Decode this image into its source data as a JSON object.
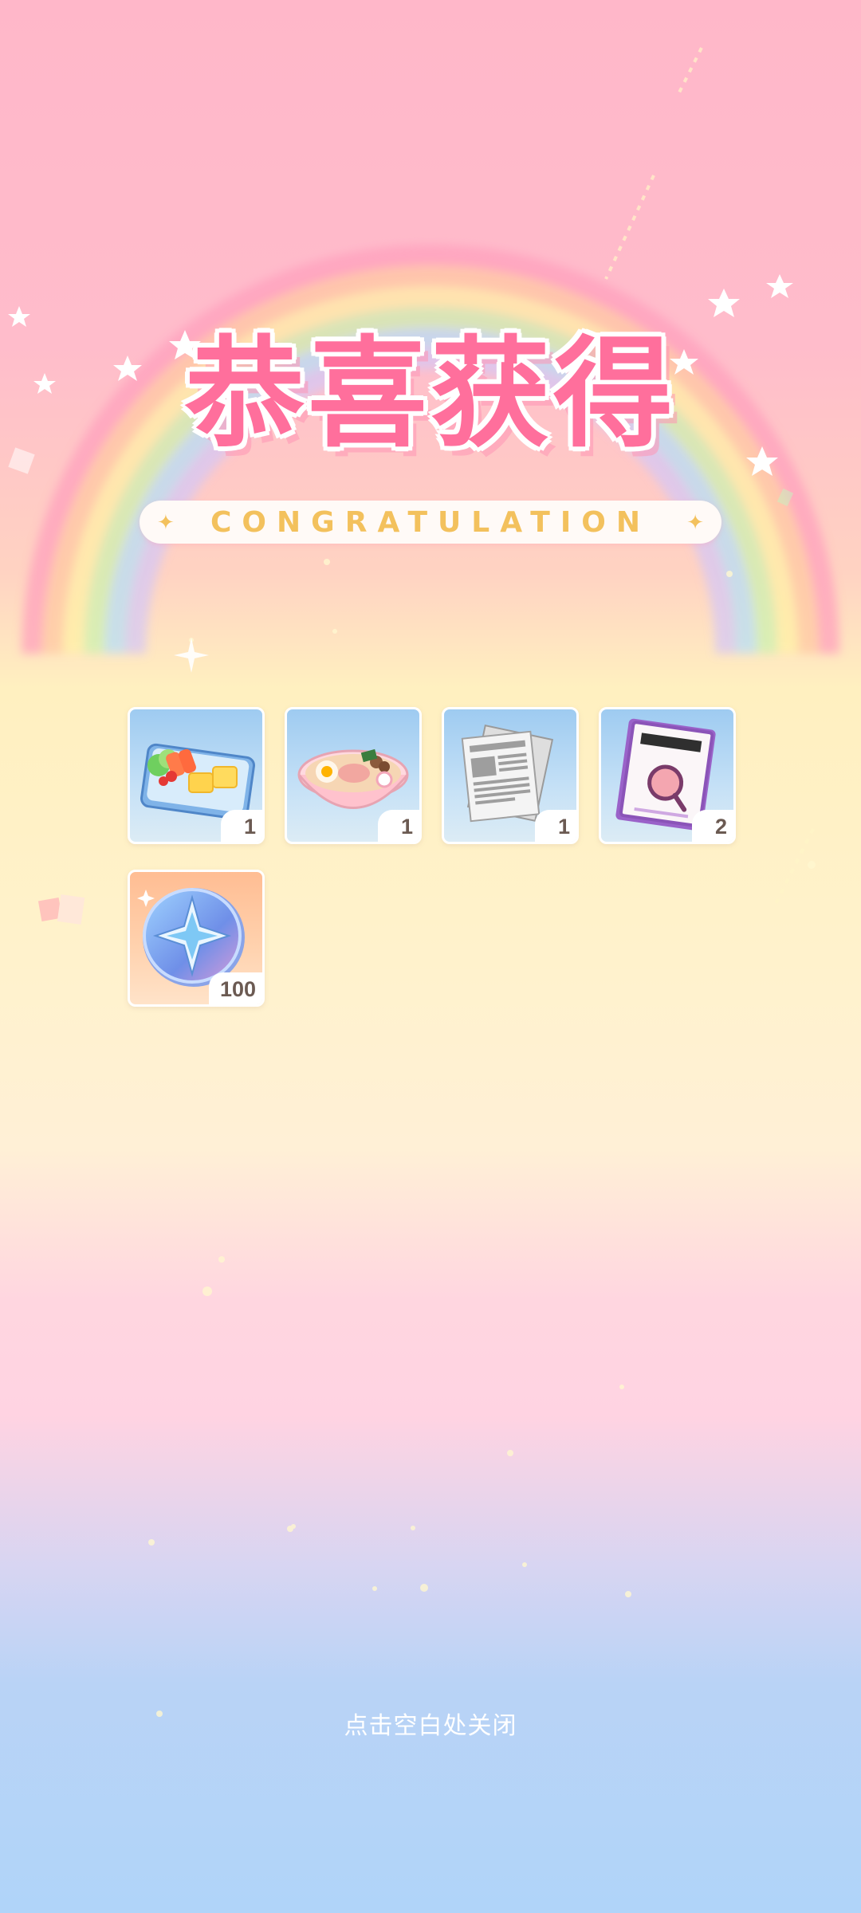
{
  "header": {
    "title": "恭喜获得",
    "subtitle": "CONGRATULATION"
  },
  "rewards": [
    {
      "name": "bento box",
      "icon": "bento-icon",
      "count": "1"
    },
    {
      "name": "ramen bowl",
      "icon": "ramen-icon",
      "count": "1"
    },
    {
      "name": "newspaper",
      "icon": "newspaper-icon",
      "count": "1"
    },
    {
      "name": "clue book",
      "icon": "clue-book-icon",
      "count": "2"
    },
    {
      "name": "star coin",
      "icon": "star-coin-icon",
      "count": "100"
    }
  ],
  "footer": {
    "close_hint": "点击空白处关闭"
  },
  "colors": {
    "title": "#ff6f9c",
    "subtitle": "#f3c15d",
    "count_text": "#6b5a52"
  }
}
